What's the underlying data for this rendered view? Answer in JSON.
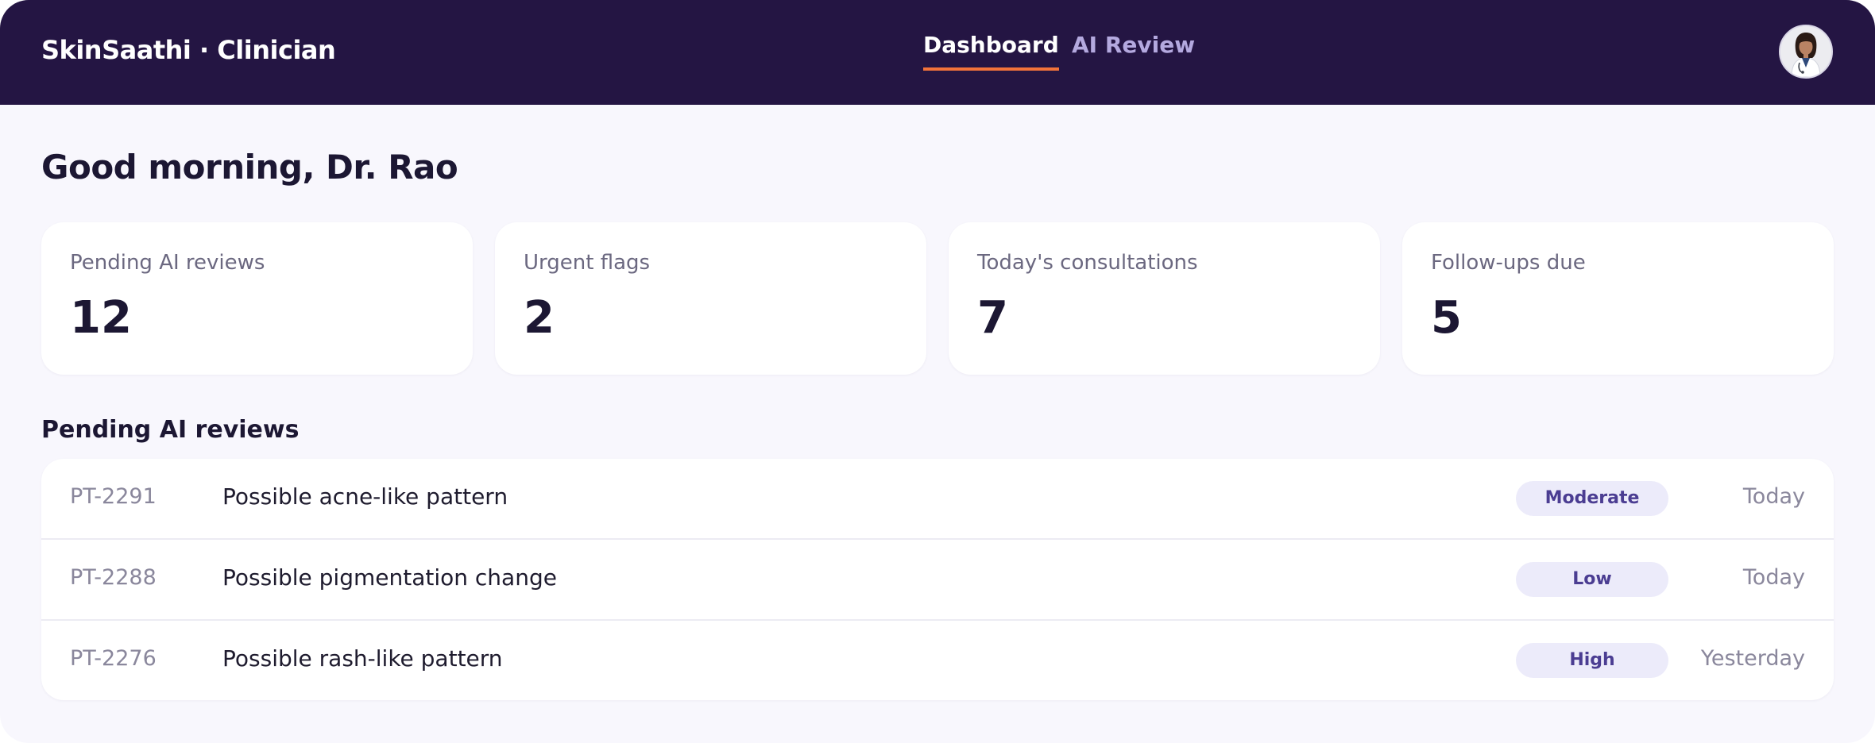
{
  "header": {
    "brand": "SkinSaathi · Clinician",
    "tabs": [
      {
        "label": "Dashboard",
        "active": true
      },
      {
        "label": "AI Review",
        "active": false
      }
    ],
    "accent_color": "#f2733a",
    "bar_color": "#241543"
  },
  "greeting": "Good morning, Dr. Rao",
  "stats": [
    {
      "label": "Pending AI reviews",
      "value": "12"
    },
    {
      "label": "Urgent flags",
      "value": "2"
    },
    {
      "label": "Today's consultations",
      "value": "7"
    },
    {
      "label": "Follow-ups due",
      "value": "5"
    }
  ],
  "pending": {
    "title": "Pending AI reviews",
    "rows": [
      {
        "id": "PT-2291",
        "finding": "Possible acne-like pattern",
        "severity": "Moderate",
        "when": "Today"
      },
      {
        "id": "PT-2288",
        "finding": "Possible pigmentation change",
        "severity": "Low",
        "when": "Today"
      },
      {
        "id": "PT-2276",
        "finding": "Possible rash-like pattern",
        "severity": "High",
        "when": "Yesterday"
      }
    ]
  }
}
